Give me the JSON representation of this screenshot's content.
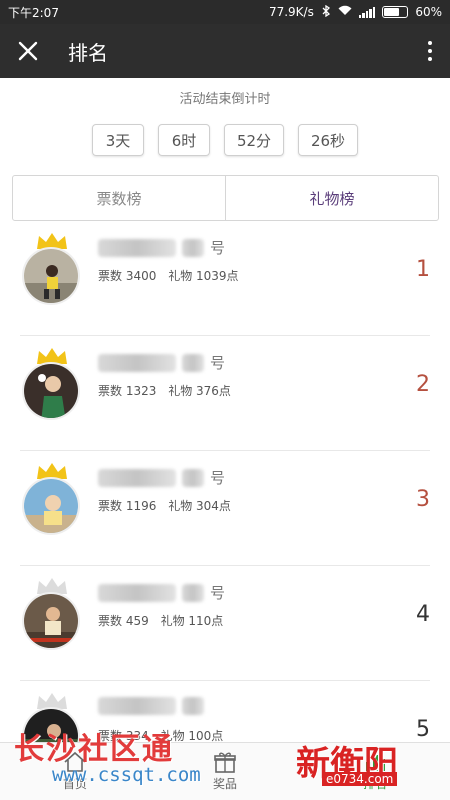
{
  "status_bar": {
    "time": "下午2:07",
    "speed": "77.9K/s",
    "battery": "60%",
    "battery_level": 0.6
  },
  "header": {
    "title": "排名",
    "close_icon": "close-icon",
    "more_icon": "more-vertical-icon"
  },
  "countdown": {
    "label": "活动结束倒计时",
    "days": "3天",
    "hours": "6时",
    "minutes": "52分",
    "seconds": "26秒"
  },
  "tabs": [
    {
      "label": "票数榜",
      "active": false
    },
    {
      "label": "礼物榜",
      "active": true
    }
  ],
  "entries": [
    {
      "name_suffix": "号",
      "votes": "票数 3400",
      "gifts": "礼物 1039点",
      "rank": "1",
      "crown": "gold"
    },
    {
      "name_suffix": "号",
      "votes": "票数 1323",
      "gifts": "礼物 376点",
      "rank": "2",
      "crown": "gold"
    },
    {
      "name_suffix": "号",
      "votes": "票数 1196",
      "gifts": "礼物 304点",
      "rank": "3",
      "crown": "gold"
    },
    {
      "name_suffix": "号",
      "votes": "票数 459",
      "gifts": "礼物 110点",
      "rank": "4",
      "crown": "silver"
    },
    {
      "name_suffix": "",
      "votes": "票数 334",
      "gifts": "礼物 100点",
      "rank": "5",
      "crown": "silver"
    }
  ],
  "bottom_nav": [
    {
      "label": "首页",
      "icon": "home-icon"
    },
    {
      "label": "奖品",
      "icon": "gift-icon"
    },
    {
      "label": "排名",
      "icon": "ranking-icon"
    }
  ],
  "watermarks": {
    "left_text": "长沙社区通",
    "left_url": "www.cssqt.com",
    "right_text": "新衡阳",
    "right_url": "e0734.com"
  },
  "colors": {
    "header_bg": "#2e2e2e",
    "active_tab": "#5a3d7a",
    "top_rank": "#b5503f",
    "crown_gold": "#f2c318",
    "crown_silver": "#dcdcdc"
  }
}
